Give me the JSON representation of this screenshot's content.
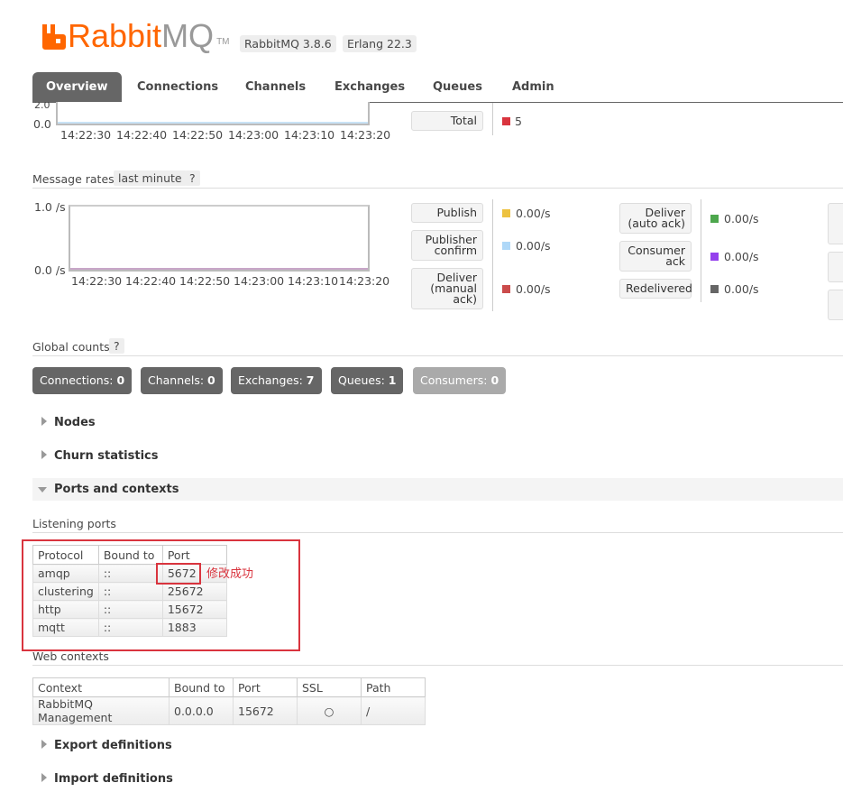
{
  "header": {
    "logo_main": "Rabbit",
    "logo_mq": "MQ",
    "logo_tm": "TM",
    "version": "RabbitMQ 3.8.6",
    "erlang": "Erlang 22.3"
  },
  "tabs": [
    "Overview",
    "Connections",
    "Channels",
    "Exchanges",
    "Queues",
    "Admin"
  ],
  "queued_chart": {
    "y_top": "2.0",
    "y_bottom": "0.0",
    "x_ticks": [
      "14:22:30",
      "14:22:40",
      "14:22:50",
      "14:23:00",
      "14:23:10",
      "14:23:20"
    ],
    "legend_total_label": "Total",
    "legend_total_value": "5",
    "legend_total_color": "#d9343e"
  },
  "message_rates": {
    "title": "Message rates",
    "range": "last minute",
    "help": "?",
    "y_top": "1.0 /s",
    "y_bottom": "0.0 /s",
    "x_ticks": [
      "14:22:30",
      "14:22:40",
      "14:22:50",
      "14:23:00",
      "14:23:10",
      "14:23:20"
    ],
    "left_legend": [
      {
        "label": "Publish",
        "value": "0.00/s",
        "color": "#edc240"
      },
      {
        "label": "Publisher confirm",
        "value": "0.00/s",
        "color": "#afd8f8"
      },
      {
        "label": "Deliver (manual ack)",
        "value": "0.00/s",
        "color": "#cb4b4b"
      }
    ],
    "right_legend": [
      {
        "label": "Deliver (auto ack)",
        "value": "0.00/s",
        "color": "#4da74d"
      },
      {
        "label": "Consumer ack",
        "value": "0.00/s",
        "color": "#9440ed"
      },
      {
        "label": "Redelivered",
        "value": "0.00/s",
        "color": "#666666"
      }
    ]
  },
  "global_counts": {
    "title": "Global counts",
    "help": "?",
    "badges": [
      {
        "label": "Connections:",
        "value": "0"
      },
      {
        "label": "Channels:",
        "value": "0"
      },
      {
        "label": "Exchanges:",
        "value": "7"
      },
      {
        "label": "Queues:",
        "value": "1"
      },
      {
        "label": "Consumers:",
        "value": "0"
      }
    ]
  },
  "sections": {
    "nodes": "Nodes",
    "churn": "Churn statistics",
    "ports": "Ports and contexts",
    "export": "Export definitions",
    "import": "Import definitions"
  },
  "listening_ports": {
    "title": "Listening ports",
    "headers": [
      "Protocol",
      "Bound to",
      "Port"
    ],
    "rows": [
      [
        "amqp",
        "::",
        "5672"
      ],
      [
        "clustering",
        "::",
        "25672"
      ],
      [
        "http",
        "::",
        "15672"
      ],
      [
        "mqtt",
        "::",
        "1883"
      ]
    ],
    "annotation": "修改成功"
  },
  "web_contexts": {
    "title": "Web contexts",
    "headers": [
      "Context",
      "Bound to",
      "Port",
      "SSL",
      "Path"
    ],
    "rows": [
      [
        "RabbitMQ Management",
        "0.0.0.0",
        "15672",
        "○",
        "/"
      ]
    ]
  }
}
